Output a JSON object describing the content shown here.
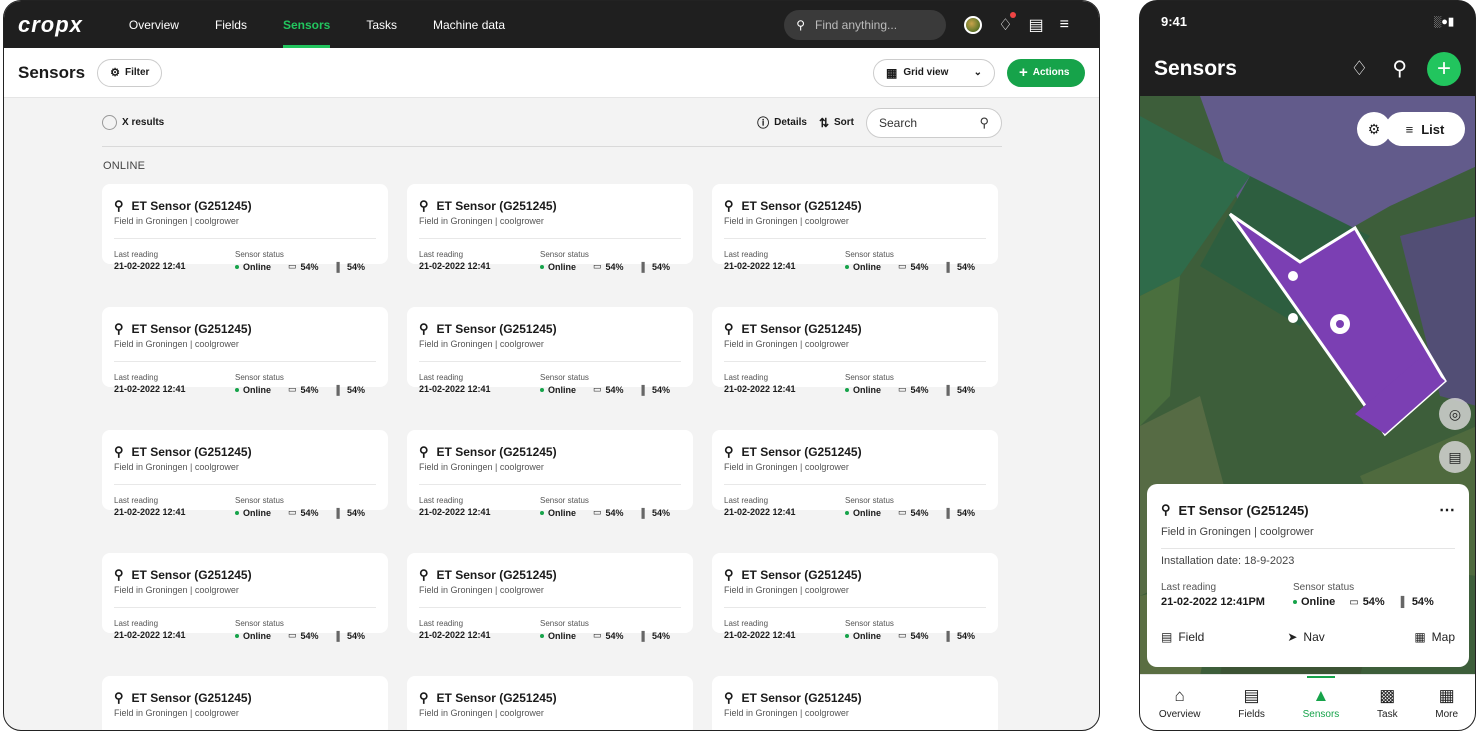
{
  "desktop": {
    "logo": "cropx",
    "nav": [
      {
        "label": "Overview",
        "active": false
      },
      {
        "label": "Fields",
        "active": false
      },
      {
        "label": "Sensors",
        "active": true
      },
      {
        "label": "Tasks",
        "active": false
      },
      {
        "label": "Machine data",
        "active": false
      }
    ],
    "search_placeholder": "Find anything...",
    "page_title": "Sensors",
    "filter_label": "Filter",
    "view_label": "Grid view",
    "actions_label": "Actions",
    "results_label": "X results",
    "details_label": "Details",
    "sort_label": "Sort",
    "search_label": "Search",
    "section_label": "ONLINE",
    "accent": "#22c55e",
    "card": {
      "title": "ET Sensor (G251245)",
      "subtitle": "Field in Groningen | coolgrower",
      "last_reading_label": "Last reading",
      "last_reading": "21-02-2022 12:41",
      "status_label": "Sensor status",
      "status": "Online",
      "battery": "54%",
      "signal": "54%"
    },
    "card_count": 15
  },
  "mobile": {
    "time": "9:41",
    "title": "Sensors",
    "list_label": "List",
    "sheet": {
      "title": "ET Sensor (G251245)",
      "subtitle": "Field in Groningen | coolgrower",
      "installation": "Installation date: 18-9-2023",
      "last_reading_label": "Last reading",
      "last_reading": "21-02-2022 12:41PM",
      "status_label": "Sensor status",
      "status": "Online",
      "battery": "54%",
      "signal": "54%",
      "actions": [
        "Field",
        "Nav",
        "Map"
      ]
    },
    "tabs": [
      {
        "label": "Overview",
        "icon": "home-icon",
        "active": false
      },
      {
        "label": "Fields",
        "icon": "fields-icon",
        "active": false
      },
      {
        "label": "Sensors",
        "icon": "sensor-icon",
        "active": true
      },
      {
        "label": "Task",
        "icon": "clipboard-icon",
        "active": false
      },
      {
        "label": "More",
        "icon": "grid-icon",
        "active": false
      }
    ]
  }
}
